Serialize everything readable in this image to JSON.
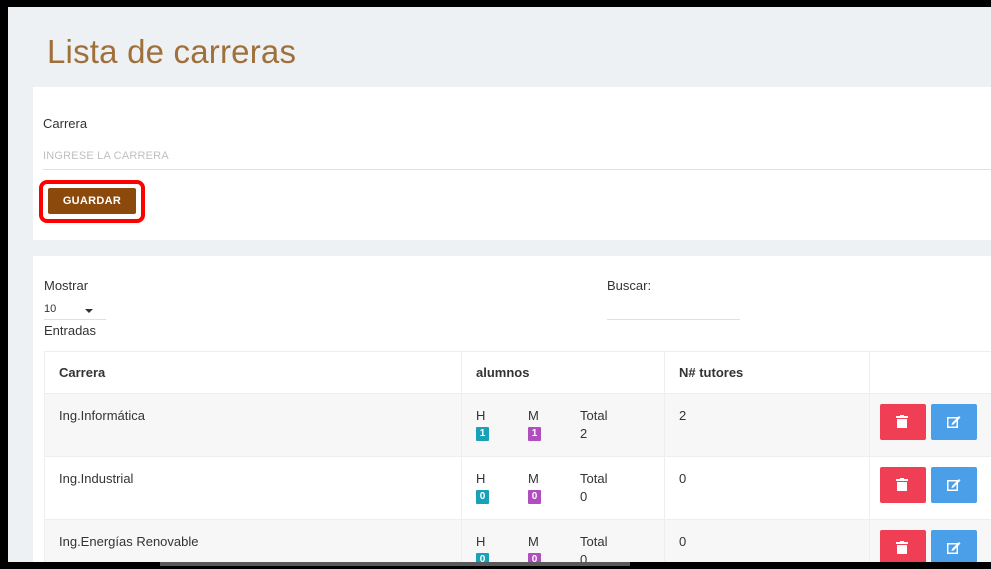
{
  "page": {
    "title": "Lista de carreras"
  },
  "form": {
    "label": "Carrera",
    "placeholder": "INGRESE LA CARRERA",
    "value": "",
    "save_label": "GUARDAR"
  },
  "table_controls": {
    "length_label": "Mostrar",
    "length_value": "10",
    "length_suffix": "Entradas",
    "search_label": "Buscar:",
    "search_value": ""
  },
  "table": {
    "headers": [
      "Carrera",
      "alumnos",
      "N# tutores",
      ""
    ],
    "rows": [
      {
        "carrera": "Ing.Informática",
        "h_label": "H",
        "h": "1",
        "m_label": "M",
        "m": "1",
        "total_label": "Total",
        "total": "2",
        "tutores": "2"
      },
      {
        "carrera": "Ing.Industrial",
        "h_label": "H",
        "h": "0",
        "m_label": "M",
        "m": "0",
        "total_label": "Total",
        "total": "0",
        "tutores": "0"
      },
      {
        "carrera": "Ing.Energías Renovable",
        "h_label": "H",
        "h": "0",
        "m_label": "M",
        "m": "0",
        "total_label": "Total",
        "total": "0",
        "tutores": "0"
      }
    ]
  },
  "icons": {
    "delete": "trash-icon",
    "edit": "edit-icon"
  },
  "colors": {
    "title": "#a0703b",
    "save_button": "#8b4a0c",
    "highlight": "#ff0000",
    "badge_h": "#17a2b8",
    "badge_m": "#b04dbf",
    "delete_button": "#f03e54",
    "edit_button": "#4a9fe8"
  }
}
